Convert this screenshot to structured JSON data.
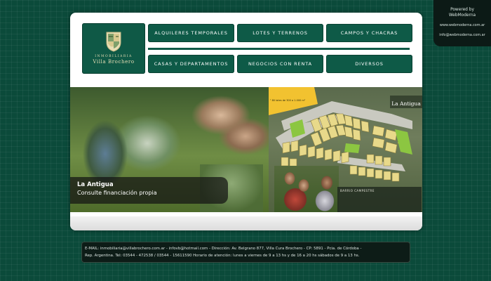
{
  "powered": {
    "line1": "Powered by",
    "line2": "WebModerna",
    "line3": "www.webmoderna.com.ar",
    "line4": "info@webmoderna.com.ar"
  },
  "logo": {
    "top_text": "INMOBILIARIA",
    "name": "Villa Brochero"
  },
  "nav": {
    "row1": [
      "ALQUILERES TEMPORALES",
      "LOTES Y TERRENOS",
      "CAMPOS Y CHACRAS"
    ],
    "row2": [
      "CASAS Y DEPARTAMENTOS",
      "NEGOCIOS CON RENTA",
      "DIVERSOS"
    ]
  },
  "banner": {
    "caption_title": "La Antigua",
    "caption_sub": "Consulte financiación propia",
    "brand": "La Antigua",
    "lots_note": "ᵉ 80 lotes de 300 a 1.000 m²",
    "info_title": "BARRIO CAMPESTRE"
  },
  "footer": {
    "line1": "E-MAIL: inmobiliaria@villabrochero.com.ar - infovb@hotmail.com - Dirección: Av. Belgrano 877, Villa Cura Brochero - CP: 5891 - Pcia. de Córdoba -",
    "line2": "Rep. Argentina. Tel: 03544 - 472538 / 03544 - 15611590 Horario de atención: lunes a viernes de 9 a 13 hs y de 16 a 20 hs sábados de 9 a 13 hs."
  },
  "colors": {
    "background": "#0b4a3a",
    "button": "#0e5a47",
    "card": "#ffffff",
    "footer": "#0d1c17",
    "lot_yellow": "#e8d98a",
    "lot_green": "#8cc641",
    "highlight_lot": "#f2c230"
  }
}
